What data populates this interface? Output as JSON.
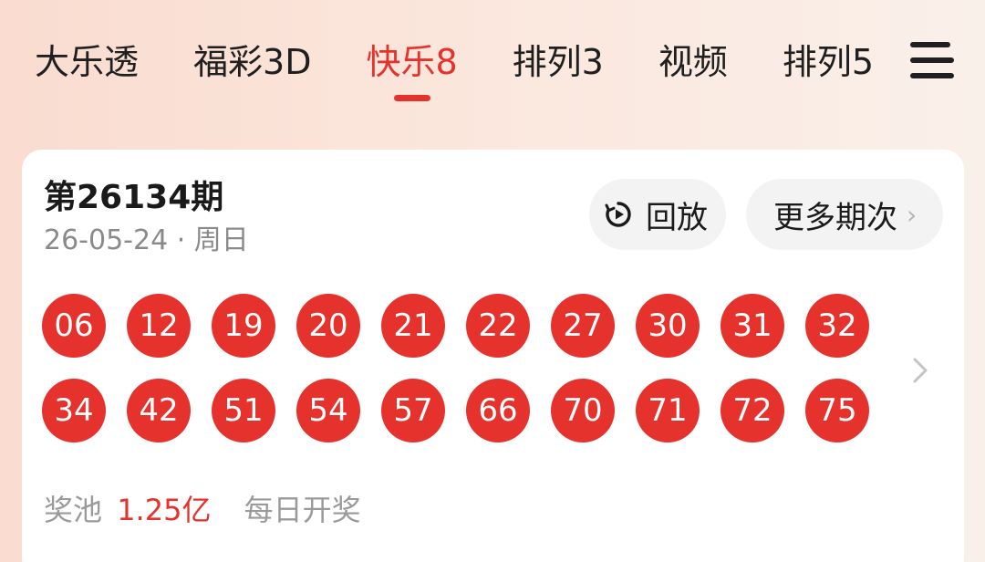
{
  "tabs": [
    {
      "label": "大乐透",
      "active": false
    },
    {
      "label": "福彩3D",
      "active": false
    },
    {
      "label": "快乐8",
      "active": true
    },
    {
      "label": "排列3",
      "active": false
    },
    {
      "label": "视频",
      "active": false
    },
    {
      "label": "排列5",
      "active": false
    }
  ],
  "draw": {
    "issue": "第26134期",
    "date_weekday": "26-05-24 · 周日",
    "replay_label": "回放",
    "more_label": "更多期次",
    "numbers": [
      "06",
      "12",
      "19",
      "20",
      "21",
      "22",
      "27",
      "30",
      "31",
      "32",
      "34",
      "42",
      "51",
      "54",
      "57",
      "66",
      "70",
      "71",
      "72",
      "75"
    ]
  },
  "footer": {
    "pool_label": "奖池",
    "pool_amount": "1.25亿",
    "schedule": "每日开奖"
  },
  "colors": {
    "accent": "#e5322d",
    "ball": "#e5322d",
    "card": "#ffffff",
    "pill": "#f3f3f3"
  },
  "icons": {
    "menu": "menu-icon",
    "replay": "replay-icon",
    "more_chevron": "chevron-right-icon",
    "card_chevron": "chevron-right-icon"
  }
}
